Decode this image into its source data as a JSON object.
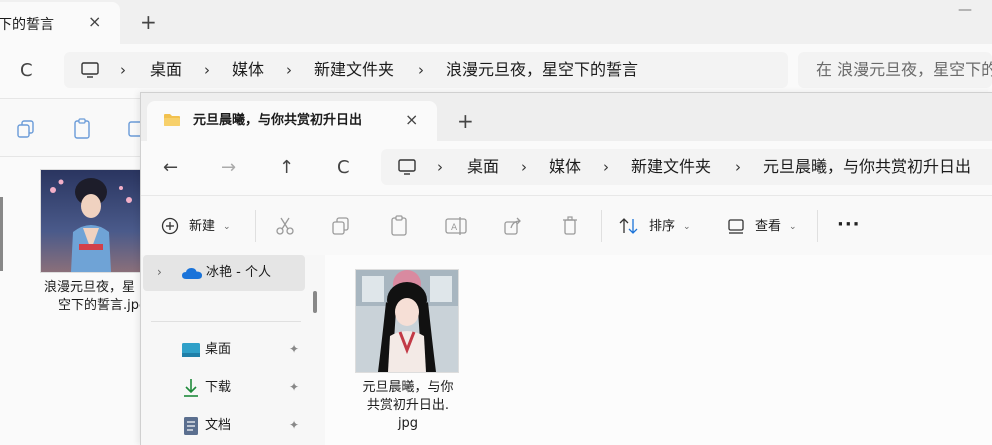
{
  "back_window": {
    "tab": {
      "title": "下的誓言",
      "close": "×",
      "add": "+"
    },
    "nav": {
      "refresh": "C"
    },
    "breadcrumb": [
      "桌面",
      "媒体",
      "新建文件夹",
      "浪漫元旦夜，星空下的誓言"
    ],
    "breadcrumb_sep": "›",
    "search_placeholder": "在 浪漫元旦夜，星空下的",
    "window_control": "—",
    "file": {
      "name_line1": "浪漫元旦夜，星",
      "name_line2": "空下的誓言.jpg"
    }
  },
  "front_window": {
    "tab": {
      "title": "元旦晨曦，与你共赏初升日出",
      "close": "×",
      "add": "+"
    },
    "nav": {
      "back": "←",
      "forward": "→",
      "up": "↑",
      "refresh": "C"
    },
    "breadcrumb": [
      "桌面",
      "媒体",
      "新建文件夹",
      "元旦晨曦，与你共赏初升日出"
    ],
    "breadcrumb_sep": "›",
    "toolbar": {
      "new_label": "新建",
      "sort_label": "排序",
      "view_label": "查看",
      "more": "···"
    },
    "nav_pane": {
      "onedrive_label": "冰艳 - 个人",
      "items": [
        {
          "label": "桌面",
          "icon": "desktop-icon"
        },
        {
          "label": "下载",
          "icon": "download-icon"
        },
        {
          "label": "文档",
          "icon": "documents-icon"
        }
      ]
    },
    "file": {
      "name_line1": "元旦晨曦，与你",
      "name_line2": "共赏初升日出.",
      "name_line3": "jpg"
    }
  },
  "colors": {
    "folder": "#f2c14e",
    "onedrive": "#1a73d9",
    "download": "#1f8a3b",
    "selection": "#e5e5e5"
  }
}
